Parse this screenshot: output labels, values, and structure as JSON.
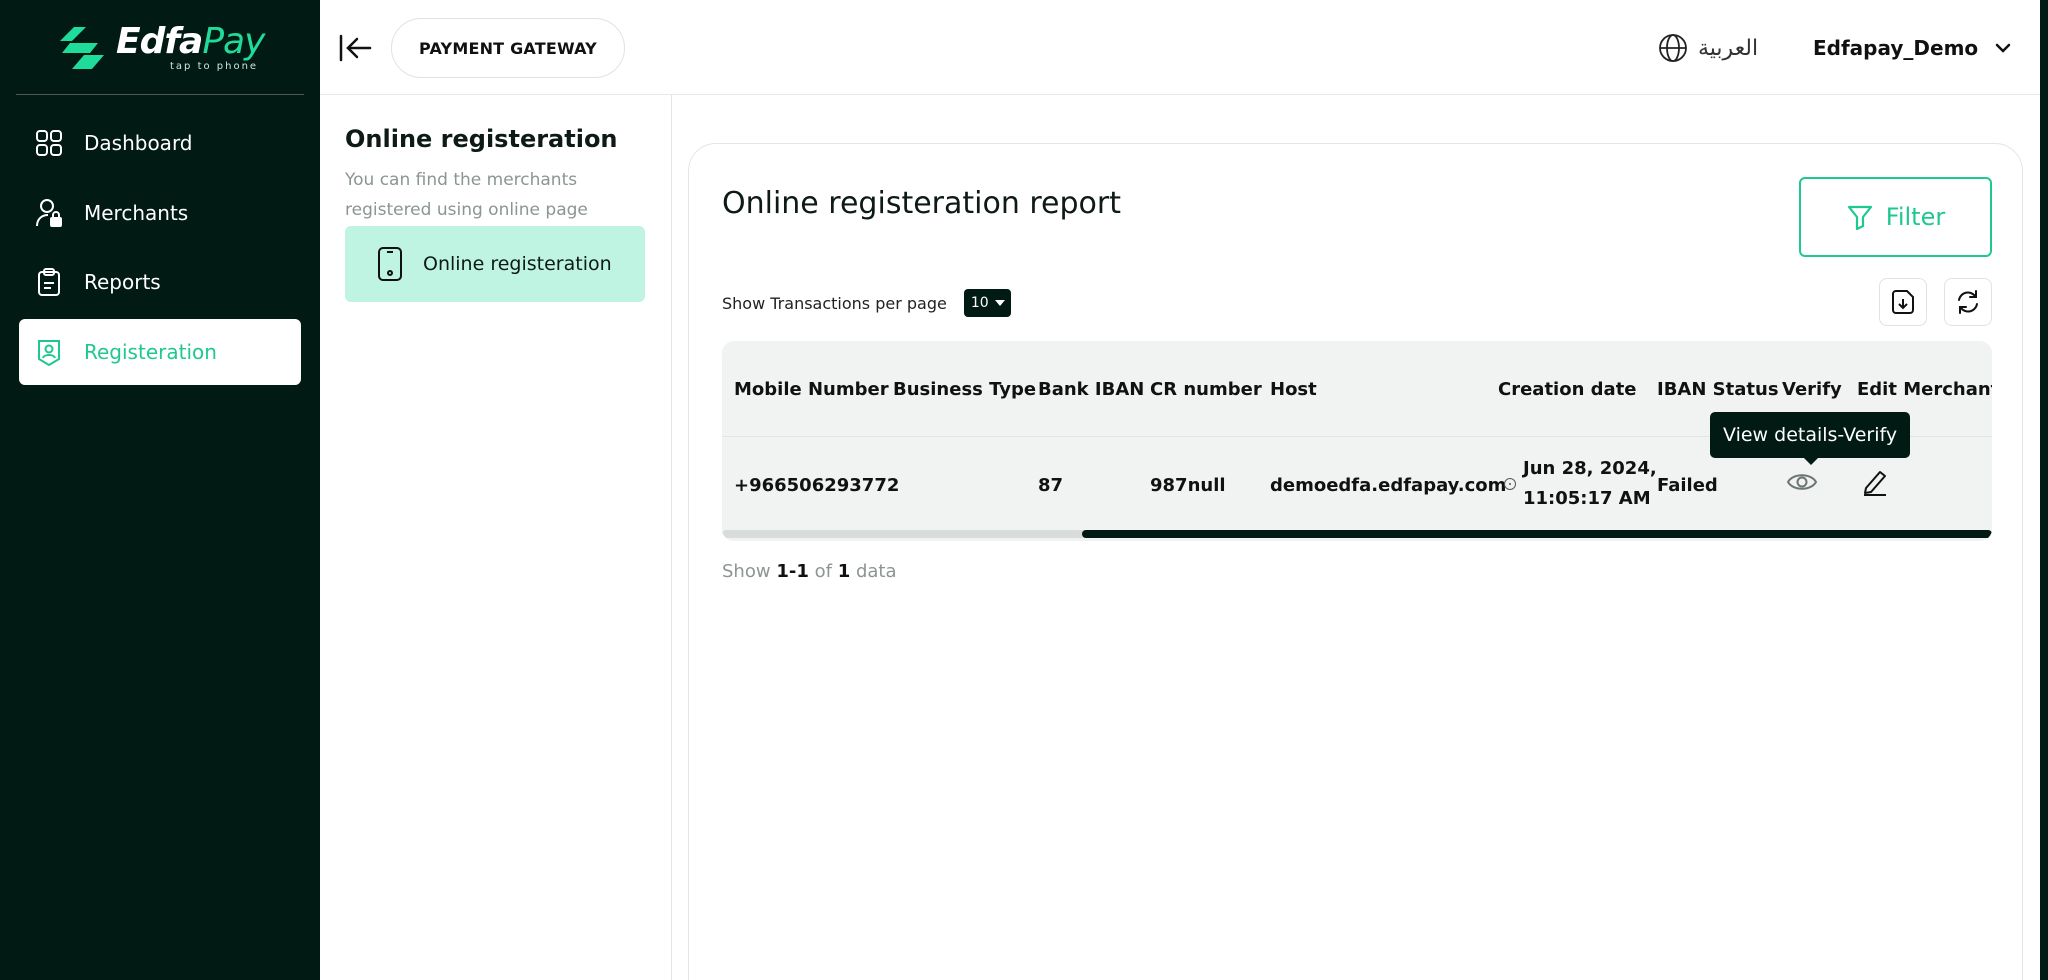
{
  "brand": {
    "name_part1": "Edfa",
    "name_part2": "Pay",
    "tagline": "tap to phone",
    "accent": "#1fc98d",
    "dark": "#011a14"
  },
  "sidebar": {
    "items": [
      {
        "label": "Dashboard",
        "icon": "grid-icon",
        "active": false
      },
      {
        "label": "Merchants",
        "icon": "user-lock-icon",
        "active": false
      },
      {
        "label": "Reports",
        "icon": "clipboard-icon",
        "active": false
      },
      {
        "label": "Registeration",
        "icon": "badge-user-icon",
        "active": true
      }
    ]
  },
  "header": {
    "gateway_label": "PAYMENT GATEWAY",
    "language_label": "العربية",
    "user_name": "Edfapay_Demo"
  },
  "subpanel": {
    "title": "Online registeration",
    "description": "You can find the merchants registered using online page",
    "item_label": "Online registeration"
  },
  "report": {
    "title": "Online registeration report",
    "filter_label": "Filter",
    "per_page_label": "Show Transactions per page",
    "per_page_value": "10",
    "columns": [
      "Mobile Number",
      "Business Type",
      "Bank IBAN",
      "CR number",
      "Host",
      "Creation date",
      "IBAN Status",
      "Verify",
      "Edit Merchant"
    ],
    "rows": [
      {
        "mobile": "+966506293772",
        "business_type": "",
        "bank_iban": "87",
        "cr_number": "987null",
        "host": "demoedfa.edfapay.com",
        "date_line1": "Jun 28, 2024,",
        "date_line2": "11:05:17 AM",
        "iban_status": "Failed"
      }
    ],
    "tooltip": "View details-Verify",
    "pager": {
      "prefix": "Show",
      "from": "1",
      "sep": "-",
      "to": "1",
      "of": "of",
      "total": "1",
      "suffix": "data"
    }
  }
}
